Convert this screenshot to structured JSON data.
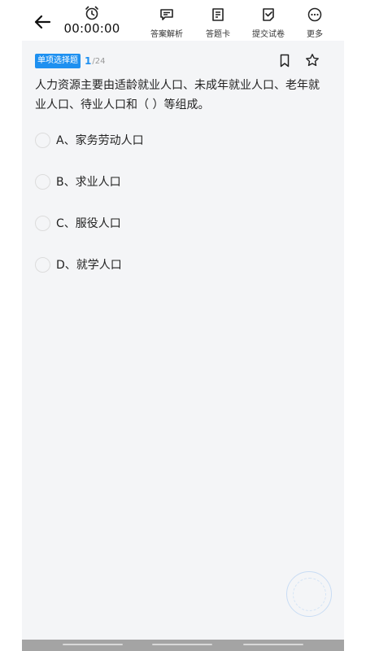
{
  "header": {
    "timer": "00:00:00",
    "tools": [
      {
        "label": "答案解析"
      },
      {
        "label": "答题卡"
      },
      {
        "label": "提交试卷"
      },
      {
        "label": "更多"
      }
    ]
  },
  "question": {
    "type_tag": "单项选择题",
    "index": "1",
    "total": "/24",
    "text": "人力资源主要由适龄就业人口、未成年就业人口、老年就业人口、待业人口和（  ）等组成。",
    "options": [
      {
        "label": "A、家务劳动人口"
      },
      {
        "label": "B、求业人口"
      },
      {
        "label": "C、服役人口"
      },
      {
        "label": "D、就学人口"
      }
    ]
  },
  "colors": {
    "accent": "#1e90f0",
    "background": "#f4f5f7"
  }
}
